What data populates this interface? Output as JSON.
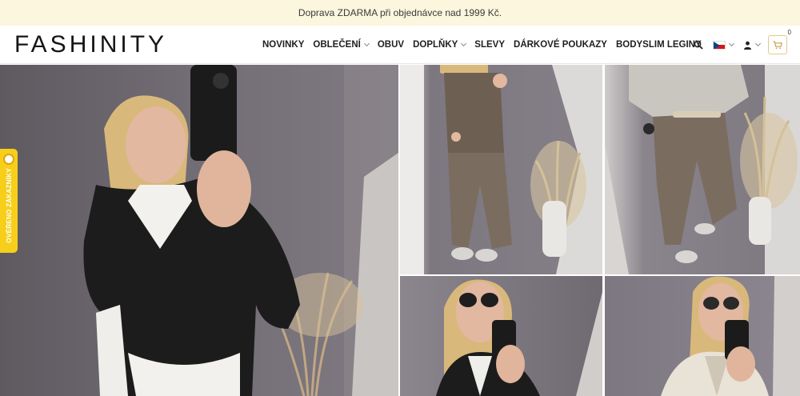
{
  "topbar": {
    "text": "Doprava ZDARMA při objednávce nad 1999 Kč."
  },
  "header": {
    "logo": "FASHINITY",
    "nav": [
      {
        "label": "NOVINKY",
        "dropdown": false
      },
      {
        "label": "OBLEČENÍ",
        "dropdown": true
      },
      {
        "label": "OBUV",
        "dropdown": false
      },
      {
        "label": "DOPLŇKY",
        "dropdown": true
      },
      {
        "label": "SLEVY",
        "dropdown": false
      },
      {
        "label": "DÁRKOVÉ POUKAZY",
        "dropdown": false
      },
      {
        "label": "BODYSLIM LEGINY",
        "dropdown": false
      }
    ],
    "tools": {
      "search_icon": "search-icon",
      "language_icon": "czech-flag-icon",
      "account_icon": "user-icon",
      "cart_icon": "cart-icon",
      "cart_count": "0"
    }
  },
  "badge": {
    "text": "OVĚŘENO ZÁKAZNÍKY"
  },
  "colors": {
    "topbar_bg": "#fbf6dd",
    "badge": "#f7cf1a",
    "cart_border": "#e3c98c"
  }
}
